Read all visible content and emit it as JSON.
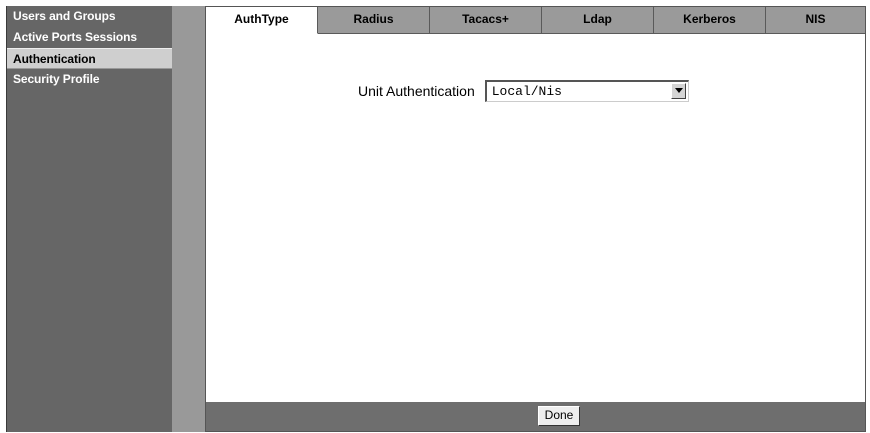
{
  "sidebar": {
    "items": [
      {
        "label": "Users and Groups",
        "active": false
      },
      {
        "label": "Active Ports Sessions",
        "active": false
      },
      {
        "label": "Authentication",
        "active": true
      },
      {
        "label": "Security Profile",
        "active": false
      }
    ]
  },
  "tabs": [
    {
      "label": "AuthType",
      "active": true
    },
    {
      "label": "Radius",
      "active": false
    },
    {
      "label": "Tacacs+",
      "active": false
    },
    {
      "label": "Ldap",
      "active": false
    },
    {
      "label": "Kerberos",
      "active": false
    },
    {
      "label": "NIS",
      "active": false
    }
  ],
  "form": {
    "unit_authentication_label": "Unit Authentication",
    "unit_authentication_value": "Local/Nis"
  },
  "footer": {
    "done_label": "Done"
  },
  "colors": {
    "sidebar_bg": "#666666",
    "sidebar_active_bg": "#cfcfcf",
    "tab_bg": "#9a9a9a",
    "tab_active_bg": "#ffffff",
    "bottom_bar_bg": "#6e6e6e"
  },
  "icons": {
    "select_arrow": "chevron-down-icon"
  }
}
